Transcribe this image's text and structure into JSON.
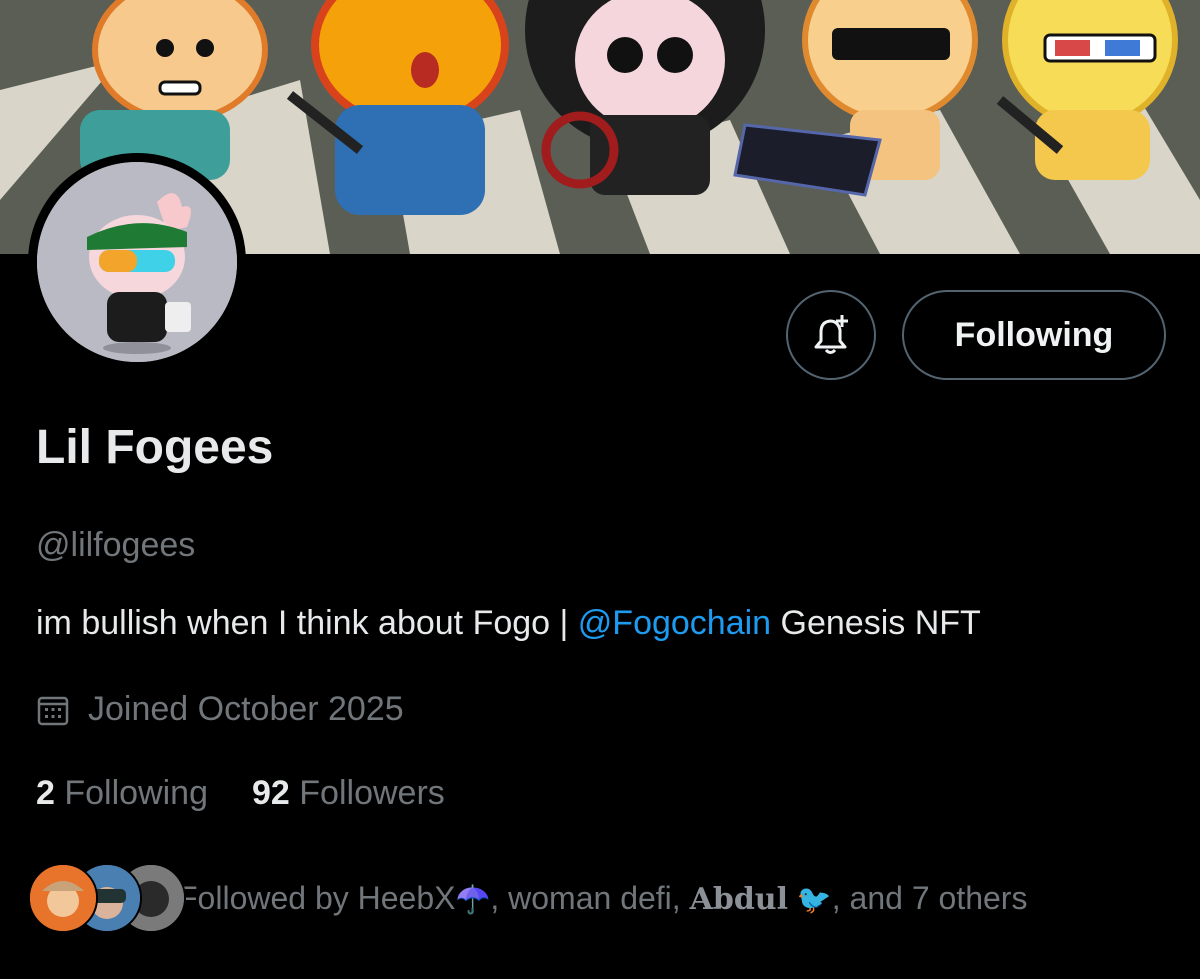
{
  "colors": {
    "background": "#000000",
    "accent": "#1d9bf0",
    "muted": "#71767b",
    "text": "#e7e9ea",
    "border": "#536471"
  },
  "banner": {
    "icon": "nft-characters-banner"
  },
  "avatar": {
    "icon": "character-avatar"
  },
  "actions": {
    "notify_icon": "bell-plus-icon",
    "follow_label": "Following"
  },
  "profile": {
    "name": "Lil Fogees",
    "handle": "@lilfogees",
    "bio_before": "im bullish when I think about Fogo | ",
    "bio_mention": "@Fogochain",
    "bio_after": " Genesis NFT",
    "joined_icon": "calendar-icon",
    "joined": "Joined October 2025"
  },
  "stats": {
    "following_count": "2",
    "following_label": "Following",
    "followers_count": "92",
    "followers_label": "Followers"
  },
  "followed_by": {
    "prefix": "Followed by HeebX",
    "emoji1": "☂️",
    "middle": ", woman defi, ",
    "abdul": "Abdul",
    "emoji2": "🐦",
    "suffix": ", and 7 others"
  }
}
